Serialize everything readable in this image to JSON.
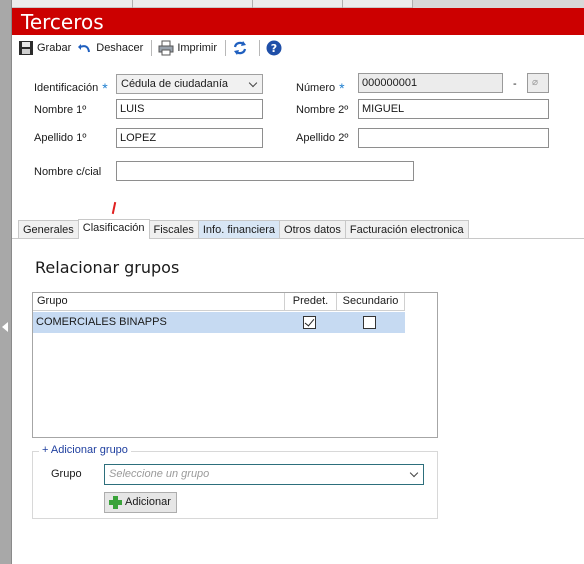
{
  "window": {
    "title": "Terceros"
  },
  "toolbar": {
    "save_label": "Grabar",
    "undo_label": "Deshacer",
    "print_label": "Imprimir"
  },
  "form": {
    "identificacion_label": "Identificación",
    "identificacion_value": "Cédula de ciudadanía",
    "numero_label": "Número",
    "numero_value": "000000001",
    "numero_dash": "-",
    "nombre1_label": "Nombre 1º",
    "nombre1_value": "LUIS",
    "nombre2_label": "Nombre 2º",
    "nombre2_value": "MIGUEL",
    "apellido1_label": "Apellido 1º",
    "apellido1_value": "LOPEZ",
    "apellido2_label": "Apellido 2º",
    "apellido2_value": "",
    "nombre_cial_label": "Nombre c/cial",
    "nombre_cial_value": "",
    "required_mark": "*"
  },
  "tabs": [
    {
      "label": "Generales"
    },
    {
      "label": "Clasificación"
    },
    {
      "label": "Fiscales"
    },
    {
      "label": "Info. financiera"
    },
    {
      "label": "Otros datos"
    },
    {
      "label": "Facturación electronica"
    }
  ],
  "section": {
    "title": "Relacionar grupos"
  },
  "grid": {
    "columns": {
      "grupo": "Grupo",
      "predet": "Predet.",
      "secundario": "Secundario"
    },
    "rows": [
      {
        "grupo": "COMERCIALES BINAPPS",
        "predet": true,
        "secundario": false
      }
    ]
  },
  "add_group": {
    "legend": "+ Adicionar grupo",
    "grupo_label": "Grupo",
    "grupo_placeholder": "Seleccione un grupo",
    "add_button": "Adicionar"
  },
  "colors": {
    "title_bar": "#cc0000",
    "selected_row": "#c6daf2",
    "required_star": "#1f7fd0",
    "link_blue": "#1f3f9f"
  }
}
